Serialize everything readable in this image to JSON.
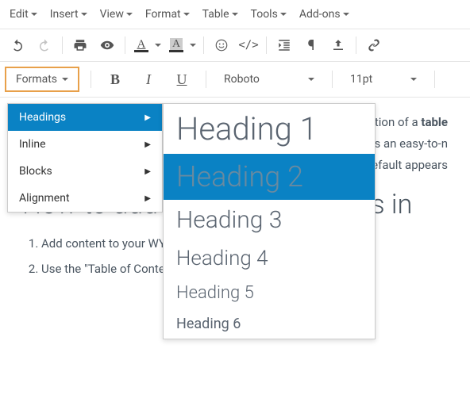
{
  "menubar": {
    "items": [
      "Edit",
      "Insert",
      "View",
      "Format",
      "Table",
      "Tools",
      "Add-ons"
    ]
  },
  "toolbar2": {
    "formats_label": "Formats",
    "font": "Roboto",
    "size": "11pt"
  },
  "dropdown": {
    "items": [
      {
        "label": "Headings",
        "active": true
      },
      {
        "label": "Inline",
        "active": false
      },
      {
        "label": "Blocks",
        "active": false
      },
      {
        "label": "Alignment",
        "active": false
      }
    ]
  },
  "submenu": {
    "items": [
      {
        "label": "Heading 1",
        "class": "h1",
        "active": false
      },
      {
        "label": "Heading 2",
        "class": "h2",
        "active": true
      },
      {
        "label": "Heading 3",
        "class": "h3",
        "active": false
      },
      {
        "label": "Heading 4",
        "class": "h4",
        "active": false
      },
      {
        "label": "Heading 5",
        "class": "h5",
        "active": false
      },
      {
        "label": "Heading 6",
        "class": "h6",
        "active": false
      }
    ]
  },
  "content": {
    "p1_a": "ation of a ",
    "p1_b": "table",
    "p2": "ds an easy-to-n",
    "p3": "default appears",
    "h2": "How to add a table of contents in",
    "li1": "Add content to your WYSIWYG as you normally do an",
    "li2": "Use the \"Table of Contents\" option in the toolbar of the WYSIW"
  }
}
